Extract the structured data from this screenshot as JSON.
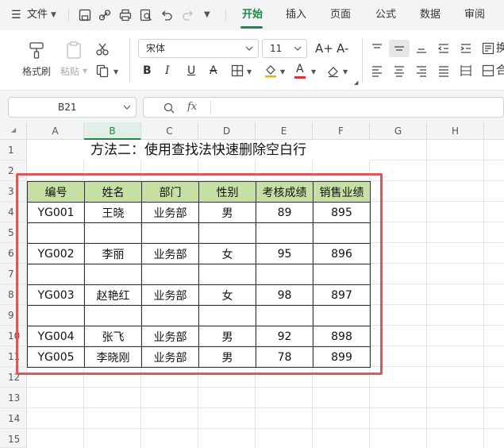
{
  "menubar": {
    "file_label": "文件",
    "tabs": [
      {
        "label": "开始",
        "active": true
      },
      {
        "label": "插入",
        "active": false
      },
      {
        "label": "页面",
        "active": false
      },
      {
        "label": "公式",
        "active": false
      },
      {
        "label": "数据",
        "active": false
      },
      {
        "label": "审阅",
        "active": false
      }
    ]
  },
  "ribbon": {
    "format_painter_label": "格式刷",
    "paste_label": "粘贴",
    "font_name": "宋体",
    "font_size": "11",
    "bold_glyph": "B",
    "italic_glyph": "I",
    "underline_glyph": "U",
    "strike_glyph": "A",
    "grow_glyph": "A+",
    "shrink_glyph": "A-",
    "font_color_glyph": "A",
    "wrap_glyph": "换",
    "merge_glyph": "合"
  },
  "formula_bar": {
    "cell_ref": "B21",
    "fx_label": "fx",
    "formula": ""
  },
  "sheet": {
    "columns": [
      "A",
      "B",
      "C",
      "D",
      "E",
      "F",
      "G",
      "H"
    ],
    "selected_column": "B",
    "rows": [
      "1",
      "2",
      "3",
      "4",
      "5",
      "6",
      "7",
      "8",
      "9",
      "10",
      "11",
      "12",
      "13",
      "14",
      "15"
    ],
    "title": "方法二：使用查找法快速删除空白行",
    "table": {
      "headers": [
        "编号",
        "姓名",
        "部门",
        "性别",
        "考核成绩",
        "销售业绩"
      ],
      "rows": [
        [
          "YG001",
          "王晓",
          "业务部",
          "男",
          "89",
          "895"
        ],
        [
          "",
          "",
          "",
          "",
          "",
          ""
        ],
        [
          "YG002",
          "李丽",
          "业务部",
          "女",
          "95",
          "896"
        ],
        [
          "",
          "",
          "",
          "",
          "",
          ""
        ],
        [
          "YG003",
          "赵艳红",
          "业务部",
          "女",
          "98",
          "897"
        ],
        [
          "",
          "",
          "",
          "",
          "",
          ""
        ],
        [
          "YG004",
          "张飞",
          "业务部",
          "男",
          "92",
          "898"
        ],
        [
          "YG005",
          "李晓刚",
          "业务部",
          "男",
          "78",
          "899"
        ]
      ]
    }
  },
  "colors": {
    "accent": "#1c8a4d",
    "header_fill": "#c6dfa3",
    "highlight_box": "#e05656"
  }
}
